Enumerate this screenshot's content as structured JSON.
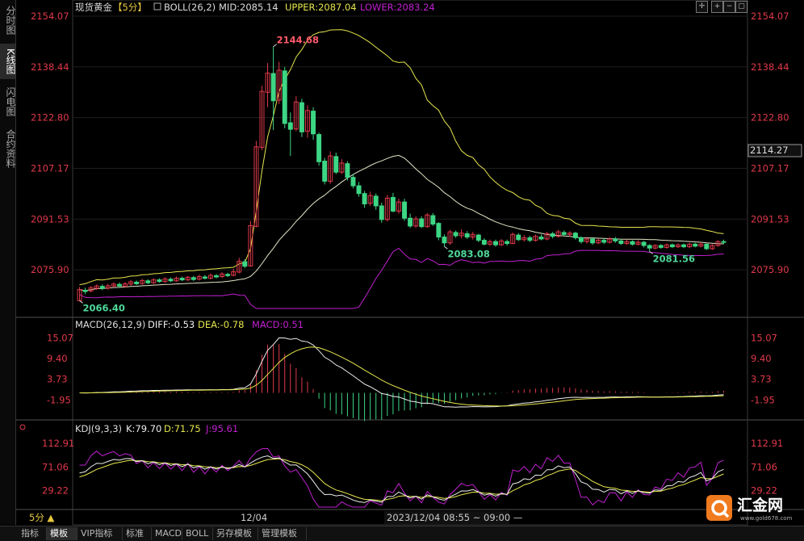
{
  "sidebar": {
    "tabs": [
      {
        "label": "分时图",
        "active": false
      },
      {
        "label": "K线图",
        "active": true
      },
      {
        "label": "闪电图",
        "active": false
      },
      {
        "label": "合约资料",
        "active": false
      }
    ]
  },
  "main_header": {
    "symbol": "现货黄金",
    "period": "【5分】",
    "indicator": "BOLL(26,2)",
    "mid": "MID:2085.14",
    "upper": "UPPER:2087.04",
    "lower": "LOWER:2083.24"
  },
  "macd_header": {
    "name": "MACD(26,12,9)",
    "diff": "DIFF:-0.53",
    "dea": "DEA:-0.78",
    "macd": "MACD:0.51"
  },
  "kdj_header": {
    "name": "KDJ(9,3,3)",
    "k": "K:79.70",
    "d": "D:71.75",
    "j": "J:95.61"
  },
  "colors": {
    "up": "#e0394a",
    "down": "#3dd684",
    "upper": "#e6e64e",
    "mid": "#e6e6c8",
    "lower": "#c020d0",
    "diff": "#eeeeee",
    "dea": "#e6e64e",
    "j": "#c020d0"
  },
  "current_price": "2114.27",
  "bottom": {
    "period_button": "5分 ▲",
    "date_label": "12/04",
    "crosshair_time": "2023/12/04 08:55 ~ 09:00 —",
    "tabs": [
      "指标",
      "模板",
      "VIP指标",
      "标准",
      "MACD",
      "BOLL",
      "另存模板",
      "管理模板"
    ],
    "active_tab": "模板"
  },
  "logo": {
    "text": "汇金网",
    "url_text": "www.gold678.com"
  },
  "chart_data": [
    {
      "type": "candlestick",
      "yticks": [
        "2154.07",
        "2138.44",
        "2122.80",
        "2107.17",
        "2091.53",
        "2075.90"
      ],
      "ylim": [
        2062,
        2154.07
      ],
      "annotations": [
        {
          "text": "2144.68",
          "type": "high"
        },
        {
          "text": "2066.40",
          "type": "low"
        },
        {
          "text": "2083.08",
          "type": "low"
        },
        {
          "text": "2081.56",
          "type": "low"
        }
      ],
      "candles": [
        [
          2066.4,
          2069.8,
          2066.4,
          2070.6
        ],
        [
          2069.6,
          2069.2,
          2068.4,
          2070.4
        ],
        [
          2069.4,
          2070.4,
          2068.9,
          2070.9
        ],
        [
          2070.2,
          2070.9,
          2069.7,
          2071.4
        ],
        [
          2070.8,
          2070.2,
          2069.6,
          2071.4
        ],
        [
          2070.3,
          2071.0,
          2069.8,
          2071.6
        ],
        [
          2070.9,
          2071.5,
          2070.4,
          2072.0
        ],
        [
          2071.4,
          2070.9,
          2070.4,
          2072.0
        ],
        [
          2070.8,
          2071.6,
          2070.5,
          2072.1
        ],
        [
          2071.5,
          2072.2,
          2071.0,
          2072.8
        ],
        [
          2072.1,
          2071.6,
          2071.2,
          2072.6
        ],
        [
          2071.7,
          2072.6,
          2071.3,
          2073.1
        ],
        [
          2072.5,
          2071.9,
          2071.5,
          2073.0
        ],
        [
          2071.9,
          2072.8,
          2071.6,
          2073.3
        ],
        [
          2072.8,
          2072.3,
          2071.9,
          2073.3
        ],
        [
          2072.3,
          2073.1,
          2071.9,
          2073.6
        ],
        [
          2073.0,
          2072.5,
          2072.1,
          2073.5
        ],
        [
          2072.5,
          2073.3,
          2072.2,
          2073.8
        ],
        [
          2073.3,
          2072.8,
          2072.4,
          2073.8
        ],
        [
          2072.8,
          2073.6,
          2072.4,
          2074.0
        ],
        [
          2073.5,
          2072.9,
          2072.5,
          2074.0
        ],
        [
          2073.0,
          2073.8,
          2072.6,
          2074.4
        ],
        [
          2073.7,
          2073.3,
          2072.9,
          2074.3
        ],
        [
          2073.3,
          2074.2,
          2073.0,
          2074.8
        ],
        [
          2074.1,
          2073.7,
          2073.3,
          2074.6
        ],
        [
          2073.8,
          2074.6,
          2073.4,
          2075.2
        ],
        [
          2074.5,
          2074.1,
          2073.7,
          2075.0
        ],
        [
          2074.2,
          2075.3,
          2073.9,
          2076.2
        ],
        [
          2075.2,
          2078.5,
          2074.8,
          2079.6
        ],
        [
          2078.4,
          2077.0,
          2076.4,
          2079.2
        ],
        [
          2077.1,
          2089.5,
          2076.8,
          2091.0
        ],
        [
          2089.3,
          2113.8,
          2089.0,
          2115.6
        ],
        [
          2113.6,
          2130.9,
          2112.8,
          2132.6
        ],
        [
          2130.6,
          2136.5,
          2126.0,
          2139.6
        ],
        [
          2136.4,
          2128.0,
          2119.0,
          2144.68
        ],
        [
          2128.2,
          2137.4,
          2127.0,
          2140.0
        ],
        [
          2137.2,
          2121.0,
          2119.5,
          2138.4
        ],
        [
          2121.2,
          2119.2,
          2111.0,
          2124.4
        ],
        [
          2119.3,
          2127.6,
          2118.6,
          2129.4
        ],
        [
          2127.4,
          2118.4,
          2116.8,
          2128.6
        ],
        [
          2118.6,
          2125.0,
          2116.6,
          2126.6
        ],
        [
          2124.8,
          2117.8,
          2116.0,
          2126.0
        ],
        [
          2117.6,
          2109.2,
          2108.0,
          2118.2
        ],
        [
          2109.4,
          2103.2,
          2102.2,
          2110.4
        ],
        [
          2103.2,
          2111.0,
          2102.4,
          2112.4
        ],
        [
          2110.8,
          2106.0,
          2105.4,
          2112.0
        ],
        [
          2106.0,
          2108.8,
          2105.4,
          2110.0
        ],
        [
          2108.6,
          2104.4,
          2103.4,
          2109.4
        ],
        [
          2104.4,
          2101.8,
          2101.0,
          2105.4
        ],
        [
          2101.8,
          2099.4,
          2098.4,
          2103.0
        ],
        [
          2099.4,
          2096.2,
          2095.0,
          2100.2
        ],
        [
          2096.4,
          2098.8,
          2095.6,
          2100.0
        ],
        [
          2098.6,
          2095.6,
          2094.4,
          2099.4
        ],
        [
          2095.6,
          2091.4,
          2090.4,
          2096.6
        ],
        [
          2091.4,
          2098.0,
          2090.8,
          2099.0
        ],
        [
          2098.2,
          2094.0,
          2093.6,
          2099.6
        ],
        [
          2094.0,
          2096.8,
          2093.2,
          2097.8
        ],
        [
          2096.8,
          2091.8,
          2091.0,
          2097.8
        ],
        [
          2091.8,
          2089.4,
          2088.8,
          2093.2
        ],
        [
          2089.4,
          2091.6,
          2088.8,
          2092.4
        ],
        [
          2091.6,
          2089.2,
          2088.8,
          2092.4
        ],
        [
          2089.2,
          2092.8,
          2088.8,
          2093.4
        ],
        [
          2092.6,
          2090.0,
          2089.4,
          2093.4
        ],
        [
          2090.2,
          2086.0,
          2085.0,
          2090.6
        ],
        [
          2086.0,
          2084.2,
          2083.08,
          2086.8
        ],
        [
          2084.2,
          2087.6,
          2083.6,
          2088.2
        ],
        [
          2087.4,
          2086.4,
          2085.8,
          2088.0
        ],
        [
          2086.4,
          2087.2,
          2085.6,
          2088.4
        ],
        [
          2087.0,
          2086.0,
          2085.4,
          2087.8
        ],
        [
          2086.0,
          2086.8,
          2085.2,
          2087.6
        ],
        [
          2086.6,
          2085.0,
          2084.4,
          2087.0
        ],
        [
          2085.0,
          2083.8,
          2083.4,
          2085.6
        ],
        [
          2083.8,
          2084.6,
          2083.2,
          2085.2
        ],
        [
          2084.6,
          2083.6,
          2083.0,
          2085.2
        ],
        [
          2083.6,
          2084.8,
          2083.2,
          2085.4
        ],
        [
          2084.6,
          2084.0,
          2083.4,
          2085.2
        ],
        [
          2084.0,
          2086.8,
          2083.8,
          2087.4
        ],
        [
          2086.6,
          2085.2,
          2084.8,
          2087.2
        ],
        [
          2085.2,
          2085.8,
          2084.6,
          2086.6
        ],
        [
          2085.8,
          2085.0,
          2084.4,
          2086.4
        ],
        [
          2085.0,
          2086.2,
          2084.6,
          2086.8
        ],
        [
          2086.0,
          2085.4,
          2085.0,
          2086.8
        ],
        [
          2085.4,
          2087.0,
          2085.0,
          2087.6
        ],
        [
          2087.0,
          2086.2,
          2085.6,
          2087.6
        ],
        [
          2086.2,
          2087.6,
          2085.8,
          2088.2
        ],
        [
          2087.4,
          2086.8,
          2086.2,
          2088.0
        ],
        [
          2086.8,
          2087.2,
          2086.2,
          2087.8
        ],
        [
          2087.2,
          2085.8,
          2085.2,
          2087.6
        ],
        [
          2085.8,
          2084.6,
          2084.0,
          2086.2
        ],
        [
          2084.6,
          2085.4,
          2084.0,
          2086.0
        ],
        [
          2085.4,
          2084.2,
          2083.6,
          2085.8
        ],
        [
          2084.2,
          2085.0,
          2083.8,
          2085.6
        ],
        [
          2085.0,
          2084.4,
          2083.8,
          2085.6
        ],
        [
          2084.4,
          2085.4,
          2084.0,
          2086.0
        ],
        [
          2085.4,
          2084.8,
          2084.2,
          2086.0
        ],
        [
          2084.8,
          2084.0,
          2083.6,
          2085.4
        ],
        [
          2084.0,
          2084.6,
          2083.6,
          2085.2
        ],
        [
          2084.6,
          2083.8,
          2083.4,
          2085.0
        ],
        [
          2083.8,
          2084.4,
          2083.4,
          2085.0
        ],
        [
          2084.4,
          2083.4,
          2082.8,
          2084.8
        ],
        [
          2083.4,
          2082.6,
          2081.56,
          2083.8
        ],
        [
          2082.6,
          2083.4,
          2082.2,
          2083.8
        ],
        [
          2083.4,
          2082.8,
          2082.4,
          2083.8
        ],
        [
          2082.8,
          2083.6,
          2082.4,
          2084.0
        ],
        [
          2083.6,
          2083.0,
          2082.6,
          2084.0
        ],
        [
          2083.0,
          2083.6,
          2082.6,
          2084.0
        ],
        [
          2083.6,
          2083.0,
          2082.6,
          2084.0
        ],
        [
          2083.0,
          2083.8,
          2082.6,
          2084.2
        ],
        [
          2083.8,
          2083.2,
          2082.8,
          2084.2
        ],
        [
          2083.2,
          2083.8,
          2082.8,
          2084.4
        ],
        [
          2083.8,
          2082.4,
          2082.0,
          2084.0
        ],
        [
          2082.4,
          2083.4,
          2082.0,
          2083.8
        ],
        [
          2083.4,
          2084.6,
          2083.0,
          2085.0
        ],
        [
          2084.6,
          2084.4,
          2083.8,
          2085.2
        ]
      ]
    },
    {
      "type": "macd",
      "yticks": [
        "15.07",
        "9.40",
        "3.73",
        "-1.95"
      ],
      "ylim": [
        -7,
        17
      ]
    },
    {
      "type": "kdj",
      "yticks": [
        "112.91",
        "71.06",
        "29.22"
      ],
      "ylim": [
        0,
        130
      ]
    }
  ]
}
